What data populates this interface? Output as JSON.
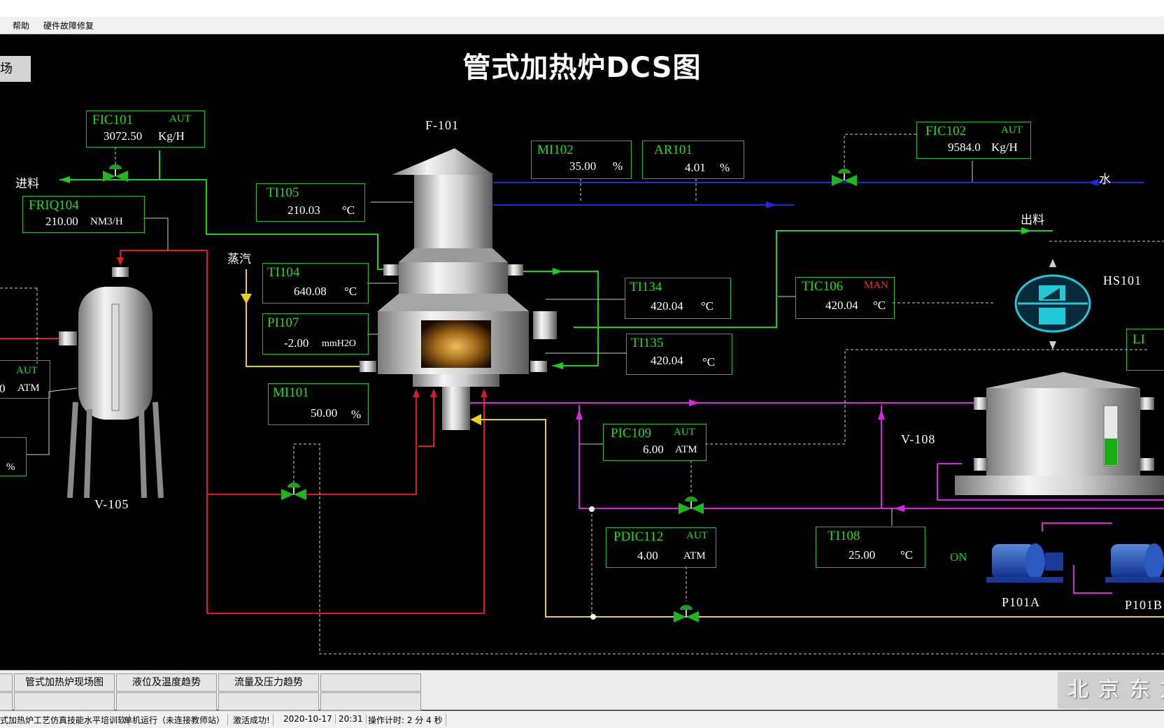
{
  "menu": {
    "help": "帮助",
    "repair": "硬件故障修复"
  },
  "scene_button": "场",
  "title": "管式加热炉DCS图",
  "equipment": {
    "f101": "F-101",
    "v105": "V-105",
    "v108": "V-108",
    "hs101": "HS101",
    "p101a": "P101A",
    "p101b": "P101B",
    "li_partial": "LI"
  },
  "labels": {
    "feed_in": "进料",
    "steam": "蒸汽",
    "water": "水",
    "product_out": "出料",
    "pump_on": "ON"
  },
  "instruments": {
    "fic101": {
      "tag": "FIC101",
      "mode": "AUT",
      "value": "3072.50",
      "unit": "Kg/H"
    },
    "friq104": {
      "tag": "FRIQ104",
      "value": "210.00",
      "unit": "NM3/H"
    },
    "ti105": {
      "tag": "TI105",
      "value": "210.03",
      "unit": "°C"
    },
    "mi102": {
      "tag": "MI102",
      "value": "35.00",
      "unit": "%"
    },
    "ar101": {
      "tag": "AR101",
      "value": "4.01",
      "unit": "%"
    },
    "fic102": {
      "tag": "FIC102",
      "mode": "AUT",
      "value": "9584.0",
      "unit": "Kg/H"
    },
    "ti104": {
      "tag": "TI104",
      "value": "640.08",
      "unit": "°C"
    },
    "pi107": {
      "tag": "PI107",
      "value": "-2.00",
      "unit": "mmH2O"
    },
    "ti134": {
      "tag": "TI134",
      "value": "420.04",
      "unit": "°C"
    },
    "ti135": {
      "tag": "TI135",
      "value": "420.04",
      "unit": "°C"
    },
    "tic106": {
      "tag": "TIC106",
      "mode": "MAN",
      "value": "420.04",
      "unit": "°C"
    },
    "mi101": {
      "tag": "MI101",
      "value": "50.00",
      "unit": "%"
    },
    "pic109": {
      "tag": "PIC109",
      "mode": "AUT",
      "value": "6.00",
      "unit": "ATM"
    },
    "pdic112": {
      "tag": "PDIC112",
      "mode": "AUT",
      "value": "4.00",
      "unit": "ATM"
    },
    "ti108": {
      "tag": "TI108",
      "value": "25.00",
      "unit": "°C"
    },
    "left_aut": {
      "mode": "AUT",
      "value": "0",
      "unit": "ATM"
    },
    "left_pct": {
      "unit": "%"
    }
  },
  "tabs": [
    "管式加热炉现场图",
    "液位及温度趋势",
    "流量及压力趋势"
  ],
  "brand": "北京东方",
  "status": {
    "app": "式加热炉工艺仿真技能水平培训软",
    "mode": "单机运行（未连接教师站）",
    "activation": "激活成功!",
    "date": "2020-10-17",
    "time": "20:31",
    "op_timer": "操作计时: 2 分 4 秒"
  },
  "v108_level": 0.45,
  "colors": {
    "feed_line": "#19d019",
    "steam_line": "#e8d020",
    "fuel_line": "#e01a1a",
    "water_line": "#1a2ae0",
    "oil_line": "#e020e0",
    "box_border": "#18c018"
  }
}
